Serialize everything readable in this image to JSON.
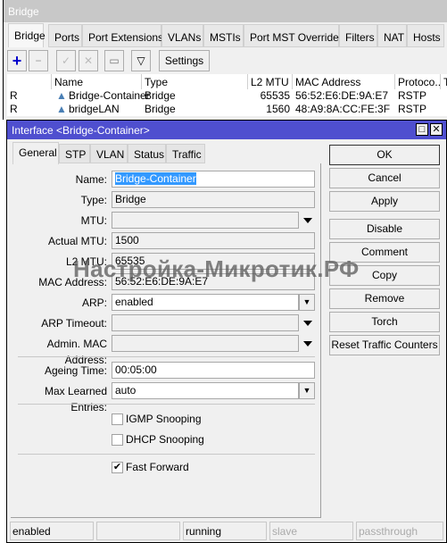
{
  "window": {
    "title": "Bridge",
    "tabs": [
      "Bridge",
      "Ports",
      "Port Extensions",
      "VLANs",
      "MSTIs",
      "Port MST Overrides",
      "Filters",
      "NAT",
      "Hosts"
    ],
    "toolbar": {
      "settings": "Settings"
    },
    "table": {
      "headers": [
        "",
        "Name",
        "Type",
        "L2 MTU",
        "MAC Address",
        "Protoco...",
        "Tx"
      ],
      "rows": [
        {
          "flag": "R",
          "name": "Bridge-Container",
          "type": "Bridge",
          "l2mtu": "65535",
          "mac": "56:52:E6:DE:9A:E7",
          "protocol": "RSTP"
        },
        {
          "flag": "R",
          "name": "bridgeLAN",
          "type": "Bridge",
          "l2mtu": "1560",
          "mac": "48:A9:8A:CC:FE:3F",
          "protocol": "RSTP"
        }
      ]
    }
  },
  "dialog": {
    "title": "Interface <Bridge-Container>",
    "tabs": [
      "General",
      "STP",
      "VLAN",
      "Status",
      "Traffic"
    ],
    "fields": {
      "name": {
        "label": "Name:",
        "value": "Bridge-Container"
      },
      "type": {
        "label": "Type:",
        "value": "Bridge"
      },
      "mtu": {
        "label": "MTU:",
        "value": ""
      },
      "actual_mtu": {
        "label": "Actual MTU:",
        "value": "1500"
      },
      "l2_mtu": {
        "label": "L2 MTU:",
        "value": "65535"
      },
      "mac": {
        "label": "MAC Address:",
        "value": "56:52:E6:DE:9A:E7"
      },
      "arp": {
        "label": "ARP:",
        "value": "enabled"
      },
      "arp_timeout": {
        "label": "ARP Timeout:",
        "value": ""
      },
      "admin_mac": {
        "label": "Admin. MAC Address:",
        "value": ""
      },
      "ageing": {
        "label": "Ageing Time:",
        "value": "00:05:00"
      },
      "max_learned": {
        "label": "Max Learned Entries:",
        "value": "auto"
      }
    },
    "checkboxes": {
      "igmp": {
        "label": "IGMP Snooping",
        "checked": false
      },
      "dhcp": {
        "label": "DHCP Snooping",
        "checked": false
      },
      "fast_forward": {
        "label": "Fast Forward",
        "checked": true
      }
    },
    "buttons": [
      "OK",
      "Cancel",
      "Apply",
      "Disable",
      "Comment",
      "Copy",
      "Remove",
      "Torch",
      "Reset Traffic Counters"
    ],
    "status": [
      "enabled",
      "",
      "running",
      "slave",
      "passthrough"
    ]
  },
  "watermark": "Настройка-Микротик.РФ",
  "colors": {
    "dialog_title": "#4f4fcf",
    "selection": "#3399ff",
    "add_icon": "#0000cc",
    "bridge_icon": "#4a7fb5"
  }
}
